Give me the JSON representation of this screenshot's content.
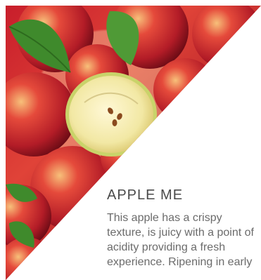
{
  "card": {
    "title": "APPLE ME",
    "description": "This apple has a crispy texture, is juicy with a point of acidity providing a fresh experience. Ripening in early"
  },
  "image": {
    "subject": "red-apples-with-leaves-and-half-cut-apple",
    "colors": {
      "apple_red": "#c81e2b",
      "leaf_green": "#3f8a2c",
      "flesh_yellow": "#f6f0b8",
      "text_title": "#4a4a4a",
      "text_body": "#6b6b6b"
    }
  }
}
